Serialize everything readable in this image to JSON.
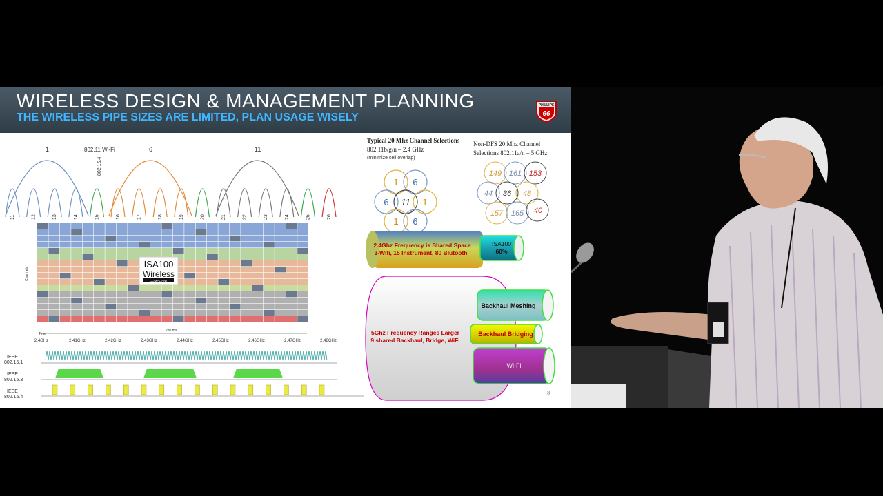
{
  "slide": {
    "title": "WIRELESS DESIGN & MANAGEMENT PLANNING",
    "subtitle": "THE WIRELESS PIPE SIZES ARE LIMITED, PLAN USAGE WISELY",
    "logo_text": "PHILLIPS 66",
    "page_number": "8"
  },
  "spectrum": {
    "wifi_label": "802.11 Wi-Fi",
    "zigbee_label": "802.15.4",
    "wifi_channels": [
      "1",
      "6",
      "11"
    ],
    "channels": [
      "11",
      "12",
      "13",
      "14",
      "15",
      "16",
      "17",
      "18",
      "19",
      "20",
      "21",
      "22",
      "23",
      "24",
      "25",
      "26"
    ],
    "isa_badge_top": "ISA100",
    "isa_badge_mid": "Wireless",
    "isa_badge_bot": "COMPLIANT",
    "grid_axis_time": "Time",
    "grid_axis_duration": "230 ms",
    "grid_axis_channels": "Channels",
    "freq_ticks": [
      "2.4GHz",
      "2.41GHz",
      "2.42GHz",
      "2.43GHz",
      "2.44GHz",
      "2.45GHz",
      "2.46GHz",
      "2.47GHz",
      "2.48GHz"
    ],
    "ieee_labels": [
      [
        "IEEE",
        "802.15.1"
      ],
      [
        "IEEE",
        "802.15.3"
      ],
      [
        "IEEE",
        "802.15.4"
      ]
    ]
  },
  "channels_24": {
    "title_line1": "Typical 20 Mhz Channel Selections",
    "title_line2": "802.11b/g/n – 2.4 GHz",
    "note": "(minimize cell overlap)",
    "cells": [
      "1",
      "6",
      "6",
      "11",
      "1",
      "1",
      "6"
    ]
  },
  "channels_5": {
    "title_line1": "Non-DFS 20 Mhz Channel",
    "title_line2": "Selections 802.11a/n – 5 GHz",
    "cells": [
      "149",
      "161",
      "153",
      "44",
      "36",
      "48",
      "157",
      "165",
      "40"
    ]
  },
  "pipes": {
    "shared_24_line1": "2.4Ghz Frequency is Shared Space",
    "shared_24_line2": "3-Wifi, 15 Instrument, 80 Blutooth",
    "isa_label": "ISA100",
    "isa_pct": "60%",
    "ghz5_line1": "5Ghz Frequency Ranges Larger",
    "ghz5_line2": "9 shared Backhaul, Bridge, WiFi",
    "backhaul_meshing": "Backhaul Meshing",
    "backhaul_bridging": "Backhaul Bridging",
    "wifi": "Wi-Fi"
  },
  "colors": {
    "header_bg": "#3a4853",
    "subtitle": "#3fb6ff",
    "shared_text": "#c00000",
    "isa_pipe": "#2ad0d0",
    "meshing_pipe": "#40e0b0",
    "bridging_pipe": "#f0f000",
    "wifi_pipe": "#c030c0"
  }
}
